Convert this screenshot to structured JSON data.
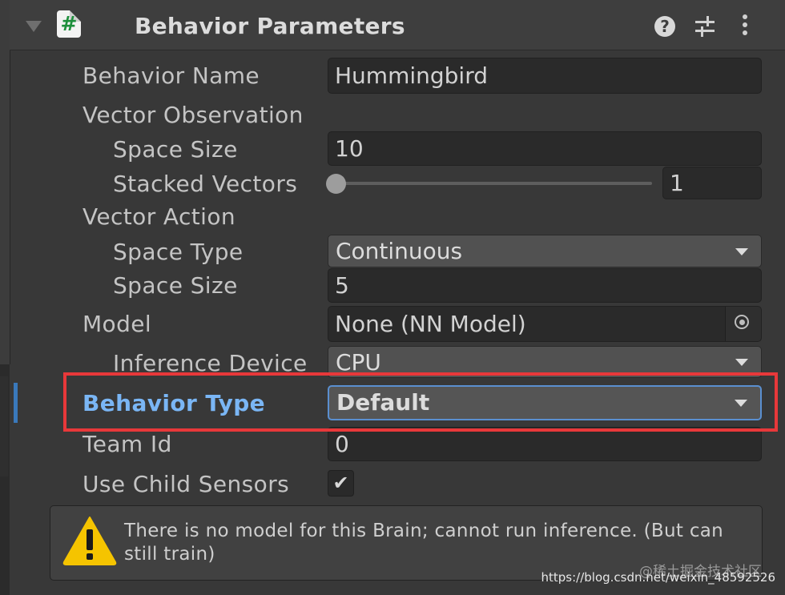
{
  "header": {
    "title": "Behavior Parameters",
    "help_glyph": "?",
    "icons": [
      "foldout-arrow-icon",
      "csharp-script-icon",
      "help-icon",
      "presets-icon",
      "kebab-menu-icon"
    ]
  },
  "fields": {
    "behavior_name": {
      "label": "Behavior Name",
      "value": "Hummingbird"
    },
    "vector_observation": {
      "label": "Vector Observation",
      "space_size": {
        "label": "Space Size",
        "value": "10"
      },
      "stacked_vectors": {
        "label": "Stacked Vectors",
        "value": "1"
      }
    },
    "vector_action": {
      "label": "Vector Action",
      "space_type": {
        "label": "Space Type",
        "value": "Continuous"
      },
      "space_size": {
        "label": "Space Size",
        "value": "5"
      }
    },
    "model": {
      "label": "Model",
      "value": "None (NN Model)",
      "inference_device": {
        "label": "Inference Device",
        "value": "CPU"
      }
    },
    "behavior_type": {
      "label": "Behavior Type",
      "value": "Default"
    },
    "team_id": {
      "label": "Team Id",
      "value": "0"
    },
    "use_child_sensors": {
      "label": "Use Child Sensors",
      "checked": true,
      "glyph": "✔"
    }
  },
  "helpbox": {
    "icon": "warning-icon",
    "message": "There is no model for this Brain; cannot run inference. (But can still train)"
  },
  "watermark": {
    "cn": "@稀土掘金技术社区",
    "url": "https://blog.csdn.net/weixin_48592526"
  },
  "colors": {
    "panel_bg": "#383838",
    "field_bg": "#2a2a2a",
    "highlight_label": "#7ab6f5",
    "annotation_red": "#e8383a",
    "warning_yellow": "#f5c400"
  }
}
